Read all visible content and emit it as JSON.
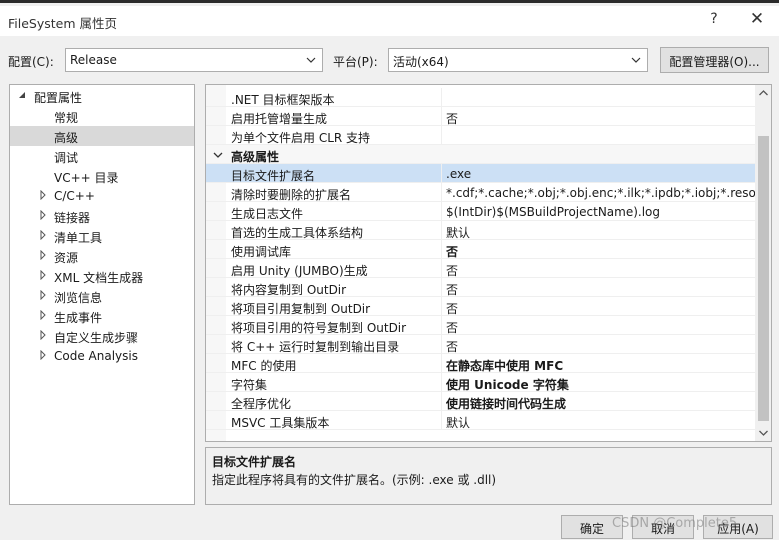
{
  "window": {
    "title": "FileSystem 属性页",
    "help_glyph": "?",
    "close_glyph": "✕"
  },
  "config": {
    "config_label": "配置(C):",
    "config_value": "Release",
    "platform_label": "平台(P):",
    "platform_value": "活动(x64)",
    "manager_button": "配置管理器(O)..."
  },
  "tree": {
    "root": "配置属性",
    "items": [
      {
        "label": "常规",
        "expandable": false
      },
      {
        "label": "高级",
        "expandable": false,
        "selected": true
      },
      {
        "label": "调试",
        "expandable": false
      },
      {
        "label": "VC++ 目录",
        "expandable": false
      },
      {
        "label": "C/C++",
        "expandable": true
      },
      {
        "label": "链接器",
        "expandable": true
      },
      {
        "label": "清单工具",
        "expandable": true
      },
      {
        "label": "资源",
        "expandable": true
      },
      {
        "label": "XML 文档生成器",
        "expandable": true
      },
      {
        "label": "浏览信息",
        "expandable": true
      },
      {
        "label": "生成事件",
        "expandable": true
      },
      {
        "label": "自定义生成步骤",
        "expandable": true
      },
      {
        "label": "Code Analysis",
        "expandable": true
      }
    ]
  },
  "grid": {
    "rows": [
      {
        "key": ".NET 目标框架版本",
        "value": ""
      },
      {
        "key": "启用托管增量生成",
        "value": "否"
      },
      {
        "key": "为单个文件启用 CLR 支持",
        "value": ""
      },
      {
        "key": "高级属性",
        "value": "",
        "category": true
      },
      {
        "key": "目标文件扩展名",
        "value": ".exe",
        "selected": true
      },
      {
        "key": "清除时要删除的扩展名",
        "value": "*.cdf;*.cache;*.obj;*.obj.enc;*.ilk;*.ipdb;*.iobj;*.resources;*.tlb;*.tli;*.tlh;*.tmp"
      },
      {
        "key": "生成日志文件",
        "value": "$(IntDir)$(MSBuildProjectName).log"
      },
      {
        "key": "首选的生成工具体系结构",
        "value": "默认"
      },
      {
        "key": "使用调试库",
        "value": "否",
        "bold": true
      },
      {
        "key": "启用 Unity (JUMBO)生成",
        "value": "否"
      },
      {
        "key": "将内容复制到 OutDir",
        "value": "否"
      },
      {
        "key": "将项目引用复制到 OutDir",
        "value": "否"
      },
      {
        "key": "将项目引用的符号复制到 OutDir",
        "value": "否"
      },
      {
        "key": "将 C++ 运行时复制到输出目录",
        "value": "否"
      },
      {
        "key": "MFC 的使用",
        "value": "在静态库中使用 MFC",
        "bold": true
      },
      {
        "key": "字符集",
        "value": "使用 Unicode 字符集",
        "bold": true
      },
      {
        "key": "全程序优化",
        "value": "使用链接时间代码生成",
        "bold": true
      },
      {
        "key": "MSVC 工具集版本",
        "value": "默认"
      }
    ]
  },
  "description": {
    "title": "目标文件扩展名",
    "text": "指定此程序将具有的文件扩展名。(示例: .exe 或 .dll)"
  },
  "buttons": {
    "ok": "确定",
    "cancel": "取消",
    "apply": "应用(A)"
  },
  "watermark": "CSDN @Complete5",
  "colors": {
    "selection": "#cce0f5",
    "window_bg": "#f0f0f0"
  }
}
